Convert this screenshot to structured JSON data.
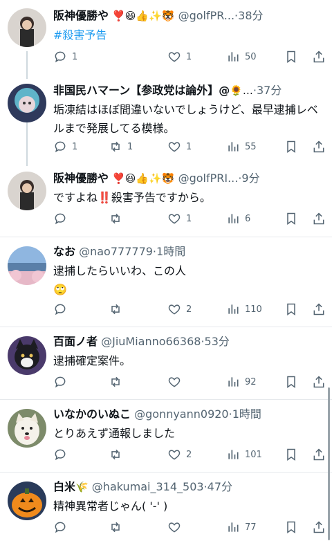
{
  "posts": [
    {
      "name": "阪神優勝や",
      "emojis": "❣️😆👍✨🐯",
      "handle": "@golfPR...",
      "time": "38分",
      "text": "",
      "hashtag": "#殺害予告",
      "reply": "1",
      "repost": "",
      "like": "1",
      "views": "50"
    },
    {
      "name": "非国民ハマーン【参政党は論外】@",
      "emojis": "🌻…",
      "handle": "",
      "time": "37分",
      "text": "垢凍結はほぼ間違いないでしょうけど、最早逮捕レベルまで発展してる模様。",
      "hashtag": "",
      "reply": "1",
      "repost": "1",
      "like": "1",
      "views": "55"
    },
    {
      "name": "阪神優勝や",
      "emojis": "❣️😆👍✨🐯",
      "handle": "@golfPRI...",
      "time": "9分",
      "text": "ですよね‼️殺害予告ですから。",
      "hashtag": "",
      "reply": "",
      "repost": "",
      "like": "1",
      "views": "6"
    },
    {
      "name": "なお",
      "emojis": "",
      "handle": "@nao777779",
      "time": "1時間",
      "text": "逮捕したらいいわ、この人",
      "hashtag": "",
      "text2": "🙄",
      "reply": "",
      "repost": "",
      "like": "2",
      "views": "110"
    },
    {
      "name": "百面ノ者",
      "emojis": "",
      "handle": "@JiuMianno66368",
      "time": "53分",
      "text": "逮捕確定案件。",
      "hashtag": "",
      "reply": "",
      "repost": "",
      "like": "",
      "views": "92"
    },
    {
      "name": "いなかのいぬこ",
      "emojis": "",
      "handle": "@gonnyann0920",
      "time": "1時間",
      "text": "とりあえず通報しました",
      "hashtag": "",
      "reply": "",
      "repost": "",
      "like": "2",
      "views": "101"
    },
    {
      "name": "白米",
      "emojis": "🌾",
      "handle": "@hakumai_314_503",
      "time": "47分",
      "text": "精神異常者じゃん( '-' )",
      "hashtag": "",
      "reply": "",
      "repost": "",
      "like": "",
      "views": "77"
    }
  ],
  "sep": "·",
  "icons": {
    "reply": "reply-icon",
    "repost": "repost-icon",
    "like": "heart-icon",
    "views": "views-icon",
    "bookmark": "bookmark-icon",
    "share": "share-icon"
  },
  "colors": {
    "text": "#0f1419",
    "muted": "#536471",
    "link": "#1d9bf0",
    "divider": "#e6e9ec"
  }
}
